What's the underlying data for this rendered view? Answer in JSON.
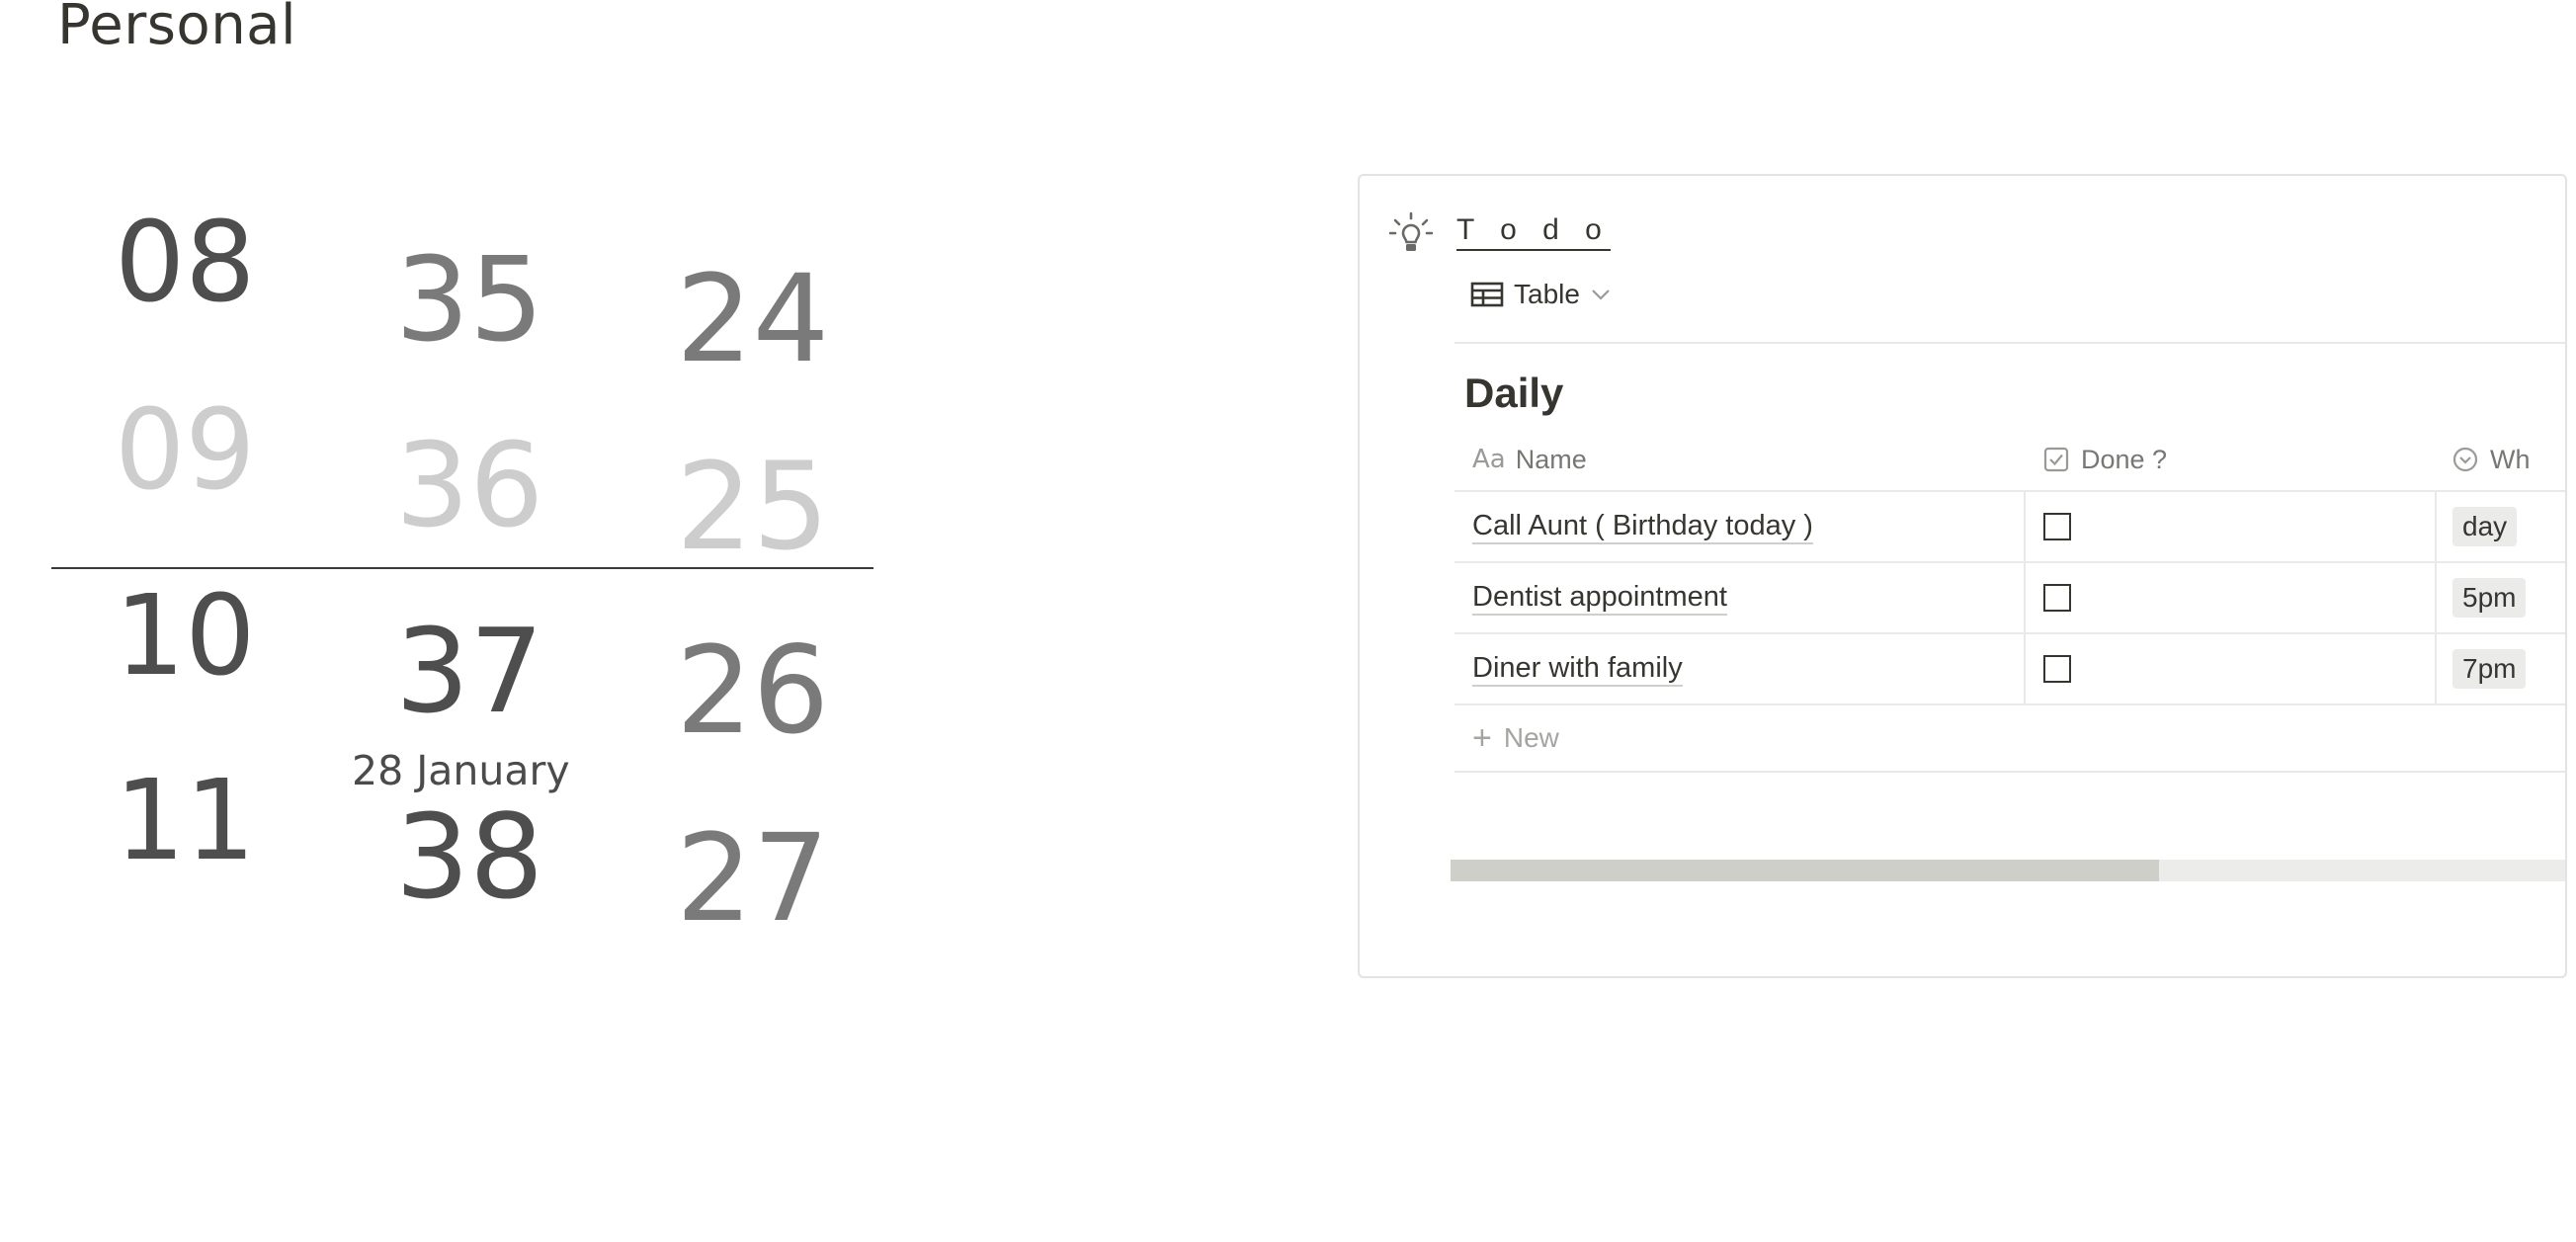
{
  "page": {
    "title": "Personal"
  },
  "clock": {
    "hours": [
      "08",
      "09",
      "10",
      "11"
    ],
    "minutes": [
      "35",
      "36",
      "37",
      "38"
    ],
    "seconds": [
      "24",
      "25",
      "26",
      "27"
    ],
    "date": "28 January"
  },
  "todo": {
    "title": "T o d o",
    "view_label": "Table",
    "section_title": "Daily",
    "columns": [
      {
        "label": "Name",
        "icon": "text-aa-icon"
      },
      {
        "label": "Done ?",
        "icon": "checkbox-icon"
      },
      {
        "label": "Wh",
        "icon": "select-circle-icon"
      }
    ],
    "rows": [
      {
        "name": "Call Aunt ( Birthday today )",
        "done": false,
        "when": "day"
      },
      {
        "name": "Dentist appointment",
        "done": false,
        "when": "5pm"
      },
      {
        "name": "Diner with family",
        "done": false,
        "when": "7pm"
      }
    ],
    "new_label": "New",
    "scroll_fraction": 0.41
  },
  "colors": {
    "text": "#37352f",
    "muted": "#787774",
    "border": "#e9e9e7",
    "tag_bg": "#ebebea",
    "clock_dark": "#4e4e4e",
    "clock_light": "#cdcdcd"
  }
}
